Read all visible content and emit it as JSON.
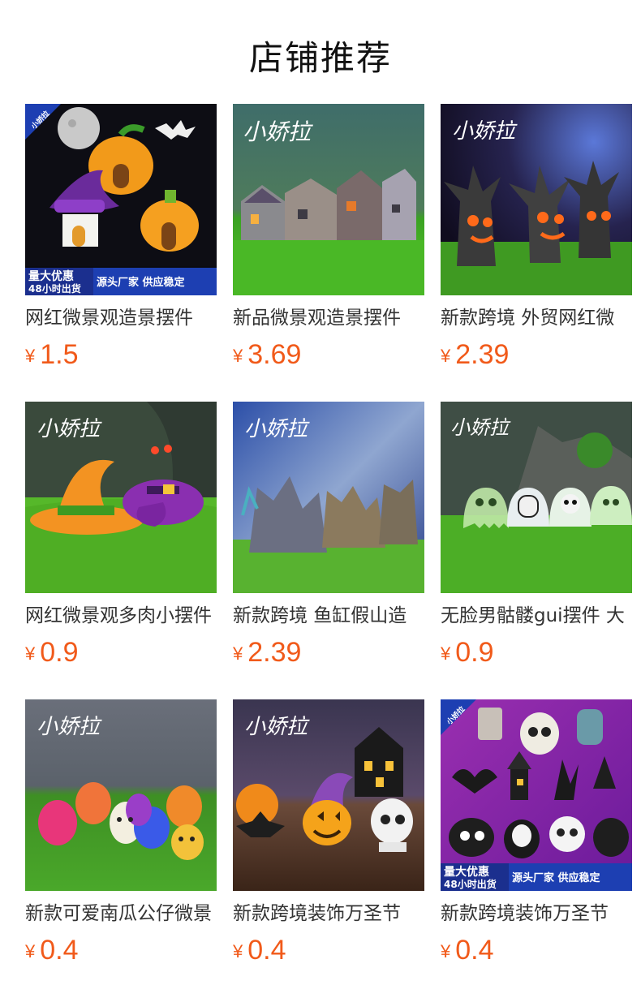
{
  "page": {
    "title": "店铺推荐"
  },
  "currency": "¥",
  "brand": {
    "script_logo": "小娇拉",
    "corner_tag": "小娇拉"
  },
  "banner": {
    "left_top": "量大优惠",
    "left_bottom": "48小时出货",
    "right": "源头厂家 供应稳定"
  },
  "colors": {
    "price": "#f15a1a",
    "text": "#333333"
  },
  "products": [
    {
      "name": "网红微景观造景摆件",
      "price": "1.5",
      "image": "halloween-pumpkin-houses"
    },
    {
      "name": "新品微景观造景摆件",
      "price": "3.69",
      "image": "miniature-haunted-houses"
    },
    {
      "name": "新款跨境 外贸网红微",
      "price": "2.39",
      "image": "spooky-trees"
    },
    {
      "name": "网红微景观多肉小摆件",
      "price": "0.9",
      "image": "witch-hats"
    },
    {
      "name": "新款跨境 鱼缸假山造",
      "price": "2.39",
      "image": "aquarium-rockery"
    },
    {
      "name": "无脸男骷髅gui摆件 大",
      "price": "0.9",
      "image": "glowing-ghosts"
    },
    {
      "name": "新款可爱南瓜公仔微景",
      "price": "0.4",
      "image": "colorful-pumpkin-figures"
    },
    {
      "name": "新款跨境装饰万圣节",
      "price": "0.4",
      "image": "pumpkin-bat-skull-decor"
    },
    {
      "name": "新款跨境装饰万圣节",
      "price": "0.4",
      "image": "halloween-figurine-set"
    }
  ]
}
